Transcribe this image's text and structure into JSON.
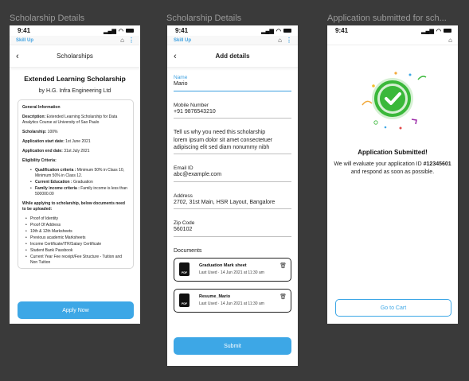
{
  "frames": {
    "f1": "Scholarship Details",
    "f2": "Scholarship Details",
    "f3": "Application submitted for sch..."
  },
  "status": {
    "time": "9:41",
    "signal": "▂▄▆",
    "wifi": "◠"
  },
  "appbar": {
    "brand": "Skill Up",
    "home": "⌂",
    "more": "⋮"
  },
  "screen1": {
    "back": "‹",
    "title": "Scholarships",
    "scholarship_name": "Extended Learning Scholarship",
    "by": "by H.G. Infra Engineering Ltd",
    "general_heading": "General Information",
    "description_label": "Description:",
    "description": " Extended Learning Scholarship for Data Analytics Course at University of Sao Paulo",
    "scholarship_label": "Scholarship:",
    "scholarship": " 100%",
    "start_label": "Application start date:",
    "start": " 1st June 2021",
    "end_label": "Application end date:",
    "end": " 31st July 2021",
    "eligibility_heading": "Eligibility Criteria:",
    "criteria": [
      {
        "label": "Qualification criteria :",
        "text": " Minimum 50% in Class 10, Minimum 50% in Class 12."
      },
      {
        "label": "Current Education :",
        "text": " Graduation"
      },
      {
        "label": "Family income criteria :",
        "text": " Family income is less than 500000.00"
      }
    ],
    "docs_heading": "While applying to scholarship, below documents need to be uploaded:",
    "docs": [
      "Proof of Identity",
      "Proof Of Address",
      "10th & 12th Marksheets",
      "Previous academic Marksheets",
      "Income Certificate/ITR/Salary Certificate",
      "Student Bank Passbook",
      "Current Year Fee receipt/Fee Structure - Tuition and Non Tuition"
    ],
    "apply_button": "Apply Now"
  },
  "screen2": {
    "back": "‹",
    "title": "Add details",
    "name_label": "Name",
    "name_value": "Mario",
    "mobile_label": "Mobile Number",
    "mobile_value": "+91 9876543210",
    "why_label": "Tell us why you need this scholarship",
    "why_value": "lorem ipsum dolor sit amet consectetuer adipiscing elit sed diam nonummy nibh",
    "email_label": "Email ID",
    "email_value": "abc@example.com",
    "address_label": "Address",
    "address_value": "2702, 31st Main, HSR Layout, Bangalore",
    "zip_label": "Zip Code",
    "zip_value": "560102",
    "documents_label": "Documents",
    "documents": [
      {
        "name": "Graduation Mark sheet",
        "meta": "Last Used  ·  14 Jun 2021 at 11:30 am"
      },
      {
        "name": "Resume_Mario",
        "meta": "Last Used  ·  14 Jun 2021 at 11:30 am"
      }
    ],
    "pdf_tag": "PDF",
    "trash": "🗑",
    "submit_button": "Submit"
  },
  "screen3": {
    "title": "Application Submitted!",
    "msg_pre": "We will evaluate your application ID ",
    "app_id": "#12345601",
    "msg_post": " and respond as soon as possible.",
    "cart_button": "Go to Cart",
    "accent": "#3ab83a"
  }
}
